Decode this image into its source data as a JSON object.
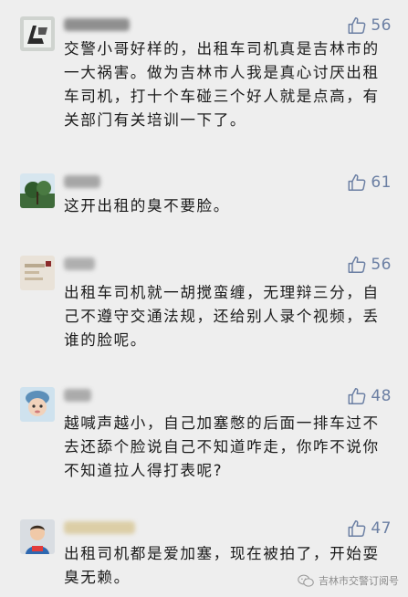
{
  "comments": [
    {
      "likes": "56",
      "text": "交警小哥好样的，出租车司机真是吉林市的一大祸害。做为吉林市人我是真心讨厌出租车司机，打十个车碰三个好人就是点高，有关部门有关培训一下了。"
    },
    {
      "likes": "61",
      "text": "这开出租的臭不要脸。"
    },
    {
      "likes": "56",
      "text": "出租车司机就一胡搅蛮缠，无理辩三分，自己不遵守交通法规，还给别人录个视频，丢谁的脸呢。"
    },
    {
      "likes": "48",
      "text": "越喊声越小，自己加塞憋的后面一排车过不去还舔个脸说自己不知道咋走，你咋不说你不知道拉人得打表呢?"
    },
    {
      "likes": "47",
      "text": "出租司机都是爱加塞，现在被拍了，开始耍臭无赖。"
    }
  ],
  "watermark": {
    "text": "吉林市交警订阅号",
    "icon": "wechat-icon"
  },
  "colors": {
    "background": "#eeeeee",
    "like": "#6b7fa3",
    "text": "#1b1b1b"
  }
}
